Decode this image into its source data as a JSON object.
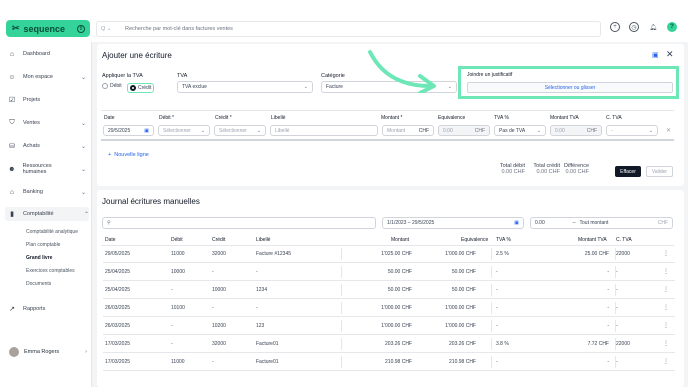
{
  "brand": {
    "name": "sequence",
    "badge": "8"
  },
  "search": {
    "scope": "Q",
    "placeholder": "Recherche par mot-clé dans factures ventes"
  },
  "sidebar": {
    "items": [
      {
        "label": "Dashboard"
      },
      {
        "label": "Mon espace"
      },
      {
        "label": "Projets"
      },
      {
        "label": "Ventes"
      },
      {
        "label": "Achats"
      },
      {
        "label": "Ressources humaines"
      },
      {
        "label": "Banking"
      },
      {
        "label": "Comptabilité"
      },
      {
        "label": "Rapports"
      }
    ],
    "sub": [
      "Comptabilité analytique",
      "Plan comptable",
      "Grand livre",
      "Exercices comptables",
      "Documents"
    ],
    "user": "Emma Rogers"
  },
  "form": {
    "title": "Ajouter une écriture",
    "tva_apply_label": "Appliquer la TVA",
    "radio_debit": "Débit",
    "radio_credit": "Crédit",
    "tva_label": "TVA",
    "tva_value": "TVA exclue",
    "cat_label": "Catégorie",
    "cat_value": "Facture",
    "attach_label": "Joindre un justificatif",
    "attach_button": "Sélectionner ou glisser",
    "headers": [
      "Date",
      "Débit *",
      "Crédit *",
      "Libellé",
      "Montant *",
      "Equivalence",
      "TVA %",
      "Montant TVA",
      "C. TVA"
    ],
    "row": {
      "date": "29/5/2025",
      "debit": "Sélectionner",
      "credit": "Sélectionner",
      "libelle": "Libellé",
      "montant": "Montant",
      "chf": "CHF",
      "eq": "0.00",
      "eq_cur": "CHF",
      "tva": "Pas de TVA",
      "mtva": "0.00",
      "mtva_cur": "CHF"
    },
    "add_line": "Nouvelle ligne",
    "totals": {
      "debit_label": "Total débit",
      "debit": "0.00 CHF",
      "credit_label": "Total crédit",
      "credit": "0.00 CHF",
      "diff_label": "Différence",
      "diff": "0.00 CHF"
    },
    "clear": "Effacer",
    "validate": "Valider"
  },
  "journal": {
    "title": "Journal écritures manuelles",
    "date_range": "1/1/2023 – 29/5/2025",
    "amount_min": "0.00",
    "amount_sep": "–",
    "amount_all": "Tout montant",
    "amount_cur": "CHF",
    "headers": [
      "Date",
      "Débit",
      "Crédit",
      "Libellé",
      "Montant",
      "Equivalence",
      "TVA %",
      "Montant TVA",
      "C. TVA"
    ],
    "rows": [
      [
        "29/05/2025",
        "11000",
        "32000",
        "Facture #12345",
        "1'025.00 CHF",
        "1'000.00 CHF",
        "2.5 %",
        "25.00 CHF",
        "22000"
      ],
      [
        "25/04/2025",
        "10000",
        "-",
        "-",
        "50.00 CHF",
        "50.00 CHF",
        "-",
        "-",
        "-"
      ],
      [
        "25/04/2025",
        "-",
        "10000",
        "1234",
        "50.00 CHF",
        "50.00 CHF",
        "-",
        "-",
        "-"
      ],
      [
        "26/03/2025",
        "10100",
        "-",
        "-",
        "1'000.00 CHF",
        "1'000.00 CHF",
        "-",
        "-",
        "-"
      ],
      [
        "26/03/2025",
        "-",
        "10200",
        "123",
        "1'000.00 CHF",
        "1'000.00 CHF",
        "-",
        "-",
        "-"
      ],
      [
        "17/03/2025",
        "-",
        "32000",
        "Facture01",
        "203.26 CHF",
        "203.26 CHF",
        "3.8 %",
        "7.72 CHF",
        "22000"
      ],
      [
        "17/03/2025",
        "11000",
        "-",
        "Facture01",
        "210.98 CHF",
        "210.98 CHF",
        "-",
        "-",
        "-"
      ]
    ]
  }
}
